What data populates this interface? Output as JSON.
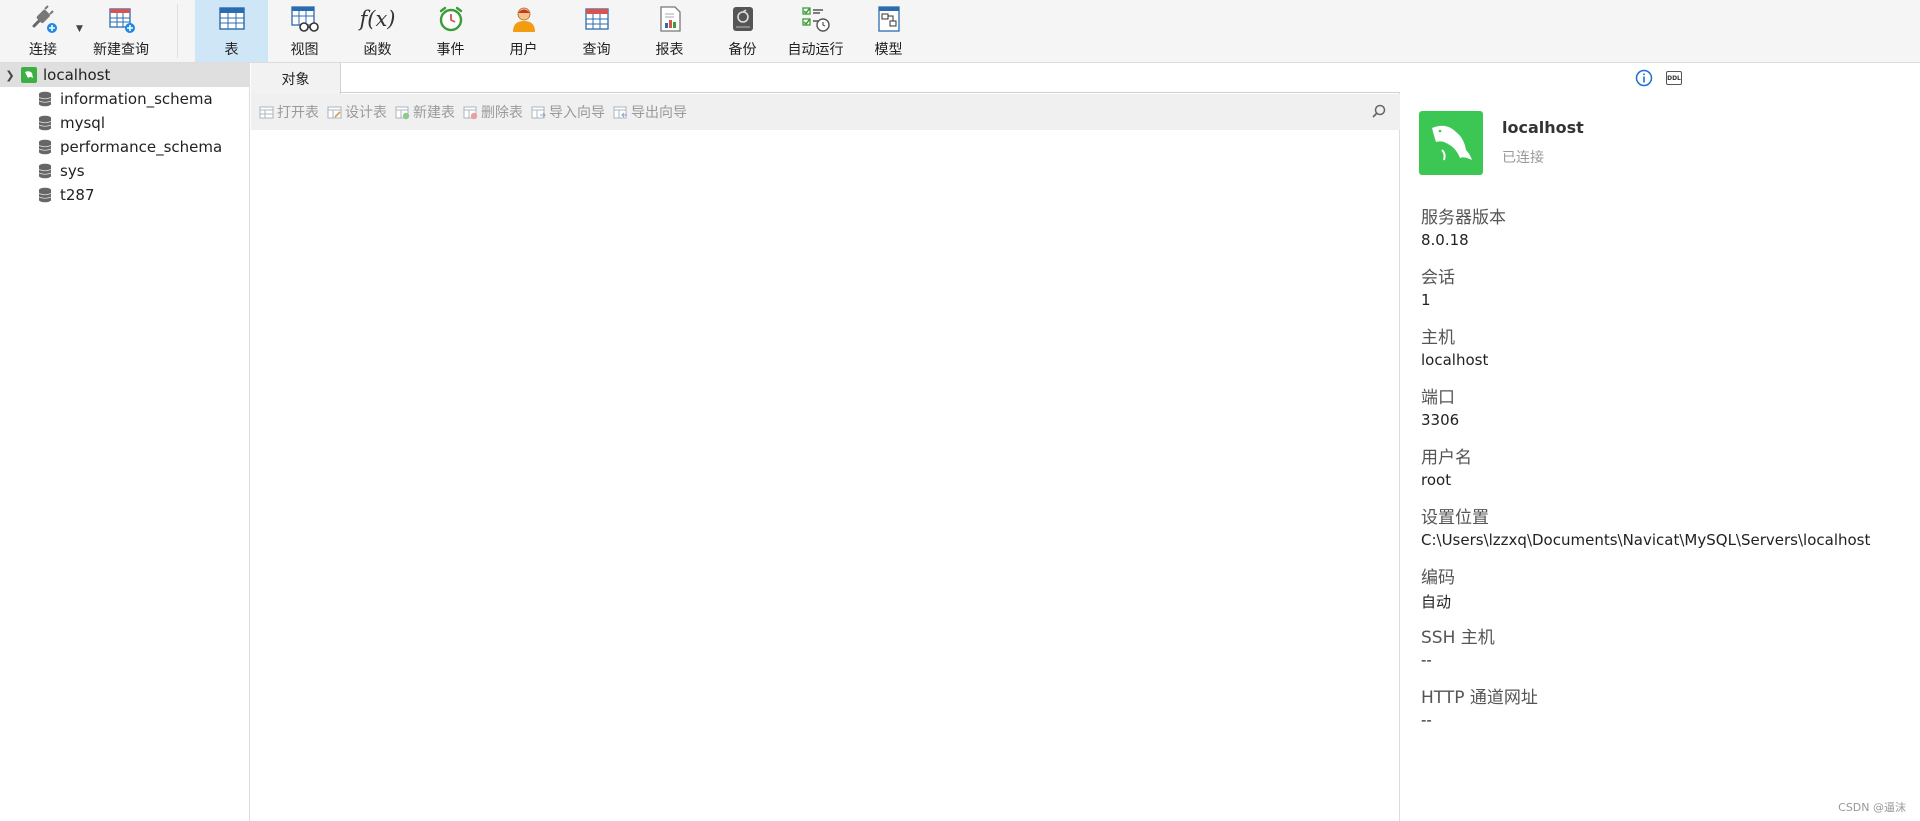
{
  "toolbar": {
    "connect": "连接",
    "new_query": "新建查询",
    "buttons": [
      {
        "id": "table",
        "label": "表",
        "active": true
      },
      {
        "id": "view",
        "label": "视图"
      },
      {
        "id": "function",
        "label": "函数"
      },
      {
        "id": "event",
        "label": "事件"
      },
      {
        "id": "user",
        "label": "用户"
      },
      {
        "id": "query",
        "label": "查询"
      },
      {
        "id": "report",
        "label": "报表"
      },
      {
        "id": "backup",
        "label": "备份"
      },
      {
        "id": "automation",
        "label": "自动运行"
      },
      {
        "id": "model",
        "label": "模型"
      }
    ],
    "function_glyph": "f(x)"
  },
  "tree": {
    "connection": "localhost",
    "databases": [
      "information_schema",
      "mysql",
      "performance_schema",
      "sys",
      "t287"
    ]
  },
  "center": {
    "tab_label": "对象",
    "object_toolbar": [
      "打开表",
      "设计表",
      "新建表",
      "删除表",
      "导入向导",
      "导出向导"
    ]
  },
  "info": {
    "name": "localhost",
    "status": "已连接",
    "ddl_label": "DDL",
    "properties": [
      {
        "key": "服务器版本",
        "value": "8.0.18"
      },
      {
        "key": "会话",
        "value": "1"
      },
      {
        "key": "主机",
        "value": "localhost"
      },
      {
        "key": "端口",
        "value": "3306"
      },
      {
        "key": "用户名",
        "value": "root"
      },
      {
        "key": "设置位置",
        "value": "C:\\Users\\lzzxq\\Documents\\Navicat\\MySQL\\Servers\\localhost"
      },
      {
        "key": "编码",
        "value": "自动"
      },
      {
        "key": "SSH 主机",
        "value": "--"
      },
      {
        "key": "HTTP 通道网址",
        "value": "--"
      }
    ]
  },
  "watermark": "CSDN @逼沫",
  "colors": {
    "accent": "#cfe6f7",
    "mysql_green": "#3cc654",
    "disabled_text": "#9a9a9a"
  }
}
